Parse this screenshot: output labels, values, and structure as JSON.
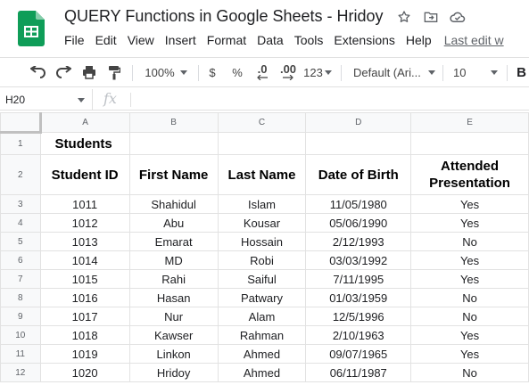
{
  "window": {
    "doc_title": "QUERY Functions in Google Sheets - Hridoy",
    "brand_color": "#0f9d58"
  },
  "menu": {
    "items": [
      "File",
      "Edit",
      "View",
      "Insert",
      "Format",
      "Data",
      "Tools",
      "Extensions",
      "Help"
    ],
    "last_edit": "Last edit w"
  },
  "toolbar": {
    "zoom": "100%",
    "currency": "$",
    "percent": "%",
    "decrease_decimal": ".0",
    "increase_decimal": ".00",
    "more_formats": "123",
    "font": "Default (Ari...",
    "font_size": "10",
    "bold": "B",
    "icons": [
      "undo-icon",
      "redo-icon",
      "print-icon",
      "paint-format-icon"
    ]
  },
  "formula_bar": {
    "name_box": "H20",
    "fx_label": "fx"
  },
  "sheet": {
    "columns": [
      "A",
      "B",
      "C",
      "D",
      "E"
    ],
    "row_numbers": [
      "1",
      "2",
      "3",
      "4",
      "5",
      "6",
      "7",
      "8",
      "9",
      "10",
      "11",
      "12"
    ],
    "title": "Students",
    "headers": [
      "Student ID",
      "First Name",
      "Last Name",
      "Date of Birth",
      "Attended Presentation"
    ],
    "rows": [
      [
        "1011",
        "Shahidul",
        "Islam",
        "11/05/1980",
        "Yes"
      ],
      [
        "1012",
        "Abu",
        "Kousar",
        "05/06/1990",
        "Yes"
      ],
      [
        "1013",
        "Emarat",
        "Hossain",
        "2/12/1993",
        "No"
      ],
      [
        "1014",
        "MD",
        "Robi",
        "03/03/1992",
        "Yes"
      ],
      [
        "1015",
        "Rahi",
        "Saiful",
        "7/11/1995",
        "Yes"
      ],
      [
        "1016",
        "Hasan",
        "Patwary",
        "01/03/1959",
        "No"
      ],
      [
        "1017",
        "Nur",
        "Alam",
        "12/5/1996",
        "No"
      ],
      [
        "1018",
        "Kawser",
        "Rahman",
        "2/10/1963",
        "Yes"
      ],
      [
        "1019",
        "Linkon",
        "Ahmed",
        "09/07/1965",
        "Yes"
      ],
      [
        "1020",
        "Hridoy",
        "Ahmed",
        "06/11/1987",
        "No"
      ]
    ]
  }
}
